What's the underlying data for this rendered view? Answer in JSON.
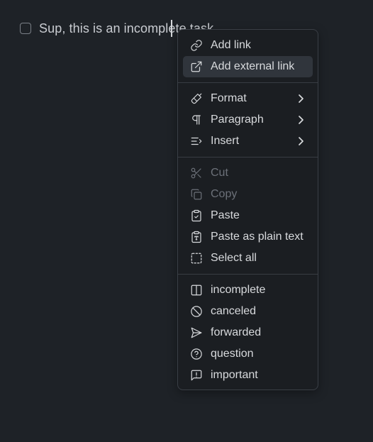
{
  "task": {
    "text": "Sup, this is an incomplete task",
    "checked": false
  },
  "context_menu": {
    "groups": [
      [
        {
          "label": "Add link",
          "icon": "link-icon",
          "disabled": false,
          "highlighted": false,
          "submenu": false
        },
        {
          "label": "Add external link",
          "icon": "external-link-icon",
          "disabled": false,
          "highlighted": true,
          "submenu": false
        }
      ],
      [
        {
          "label": "Format",
          "icon": "paintbrush-icon",
          "disabled": false,
          "highlighted": false,
          "submenu": true
        },
        {
          "label": "Paragraph",
          "icon": "pilcrow-icon",
          "disabled": false,
          "highlighted": false,
          "submenu": true
        },
        {
          "label": "Insert",
          "icon": "list-plus-icon",
          "disabled": false,
          "highlighted": false,
          "submenu": true
        }
      ],
      [
        {
          "label": "Cut",
          "icon": "scissors-icon",
          "disabled": true,
          "highlighted": false,
          "submenu": false
        },
        {
          "label": "Copy",
          "icon": "copy-icon",
          "disabled": true,
          "highlighted": false,
          "submenu": false
        },
        {
          "label": "Paste",
          "icon": "clipboard-check-icon",
          "disabled": false,
          "highlighted": false,
          "submenu": false
        },
        {
          "label": "Paste as plain text",
          "icon": "clipboard-type-icon",
          "disabled": false,
          "highlighted": false,
          "submenu": false
        },
        {
          "label": "Select all",
          "icon": "select-all-icon",
          "disabled": false,
          "highlighted": false,
          "submenu": false
        }
      ],
      [
        {
          "label": "incomplete",
          "icon": "half-square-icon",
          "disabled": false,
          "highlighted": false,
          "submenu": false
        },
        {
          "label": "canceled",
          "icon": "ban-icon",
          "disabled": false,
          "highlighted": false,
          "submenu": false
        },
        {
          "label": "forwarded",
          "icon": "send-icon",
          "disabled": false,
          "highlighted": false,
          "submenu": false
        },
        {
          "label": "question",
          "icon": "question-circle-icon",
          "disabled": false,
          "highlighted": false,
          "submenu": false
        },
        {
          "label": "important",
          "icon": "alert-message-icon",
          "disabled": false,
          "highlighted": false,
          "submenu": false
        }
      ]
    ]
  },
  "colors": {
    "background": "#1e2227",
    "menu_background": "#1b1e22",
    "menu_border": "#3a3f46",
    "highlight": "#30353c",
    "text": "#d8dadd",
    "disabled_text": "#6c7179"
  }
}
